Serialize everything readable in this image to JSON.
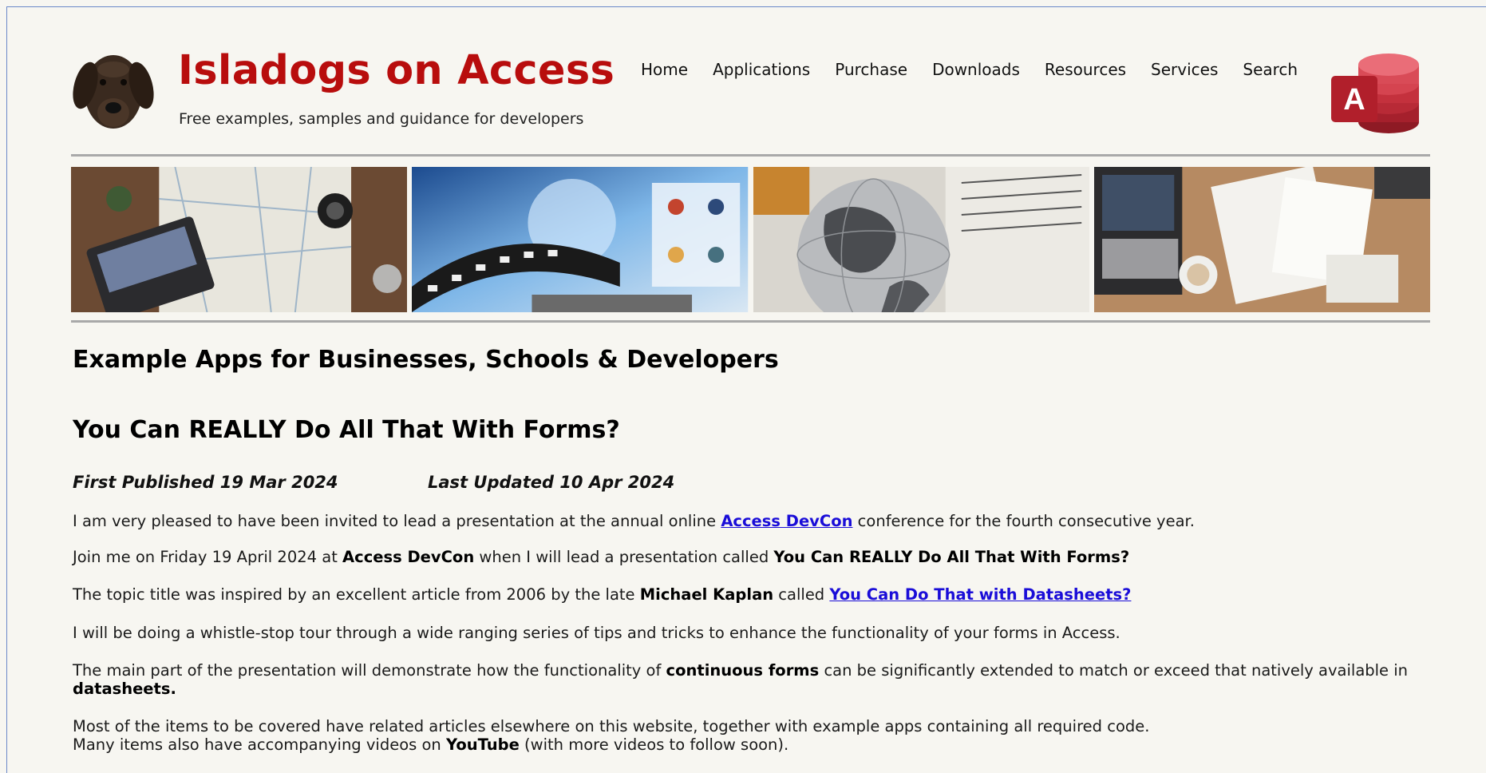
{
  "site": {
    "title": "Isladogs on Access",
    "tagline": "Free examples, samples and guidance for developers",
    "access_logo_letter": "A"
  },
  "nav": [
    {
      "label": "Home"
    },
    {
      "label": "Applications"
    },
    {
      "label": "Purchase"
    },
    {
      "label": "Downloads"
    },
    {
      "label": "Resources"
    },
    {
      "label": "Services"
    },
    {
      "label": "Search"
    }
  ],
  "banner": {
    "panels": [
      "map-laptop-image",
      "media-film-image",
      "globe-newspaper-image",
      "desk-papers-image"
    ]
  },
  "page": {
    "section_heading": "Example Apps for Businesses, Schools & Developers",
    "article_title": "You Can REALLY Do All That With Forms?",
    "first_published": "First Published 19 Mar 2024",
    "last_updated": "Last Updated 10 Apr 2024"
  },
  "paragraphs": {
    "p1_pre": "I am very pleased to have been invited to lead a presentation at the annual online ",
    "p1_link": "Access DevCon",
    "p1_post": " conference for the fourth consecutive year.",
    "p2_pre": "Join me on Friday 19 April 2024 at ",
    "p2_bold1": "Access DevCon",
    "p2_mid": " when I will lead a presentation called ",
    "p2_bold2": "You Can REALLY Do All That With Forms?",
    "p3_pre": "The topic title was inspired by an excellent article from 2006 by the late ",
    "p3_bold": "Michael Kaplan",
    "p3_mid": " called ",
    "p3_link": "You Can Do That with Datasheets?",
    "p4": "I will be doing a whistle-stop tour through a wide ranging series of tips and tricks to enhance the functionality of your forms in Access.",
    "p5_pre": "The main part of the presentation will demonstrate how the functionality of ",
    "p5_bold1": "continuous forms",
    "p5_mid": " can be significantly extended to match or exceed that natively available in ",
    "p5_bold2": "datasheets.",
    "p6_line1": "Most of the items to be covered have related articles elsewhere on this website, together with example apps containing all required code.",
    "p6_pre": "Many items also have accompanying videos on ",
    "p6_bold": "YouTube",
    "p6_post": " (with more videos to follow soon)."
  },
  "colors": {
    "brand_red": "#b80d0d",
    "link_blue": "#1a0dd8",
    "page_bg": "#f7f6f1"
  }
}
